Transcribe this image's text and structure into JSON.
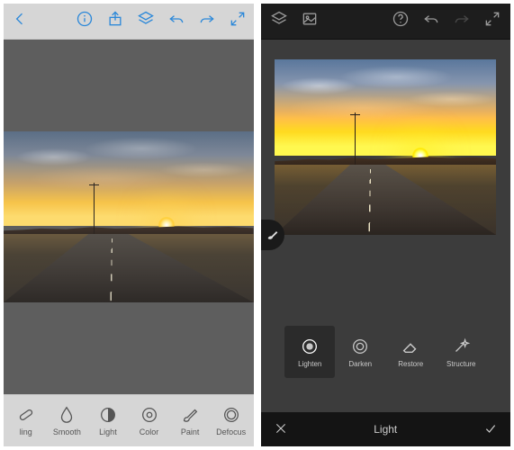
{
  "left": {
    "topbar": {
      "back": "back-chevron",
      "info": "info-icon",
      "share": "share-icon",
      "layers": "layers-icon",
      "undo": "undo-icon",
      "redo": "redo-icon",
      "expand": "expand-icon"
    },
    "tools": [
      {
        "id": "healing",
        "label": "ling"
      },
      {
        "id": "smooth",
        "label": "Smooth"
      },
      {
        "id": "light",
        "label": "Light"
      },
      {
        "id": "color",
        "label": "Color"
      },
      {
        "id": "paint",
        "label": "Paint"
      },
      {
        "id": "defocus",
        "label": "Defocus"
      }
    ]
  },
  "right": {
    "topbar": {
      "layers": "layers-icon",
      "image": "image-icon",
      "help": "help-icon",
      "undo": "undo-icon",
      "redo": "redo-icon",
      "expand": "expand-icon"
    },
    "tools": [
      {
        "id": "lighten",
        "label": "Lighten",
        "active": true
      },
      {
        "id": "darken",
        "label": "Darken",
        "active": false
      },
      {
        "id": "restore",
        "label": "Restore",
        "active": false
      },
      {
        "id": "structure",
        "label": "Structure",
        "active": false
      }
    ],
    "mode_label": "Light"
  }
}
